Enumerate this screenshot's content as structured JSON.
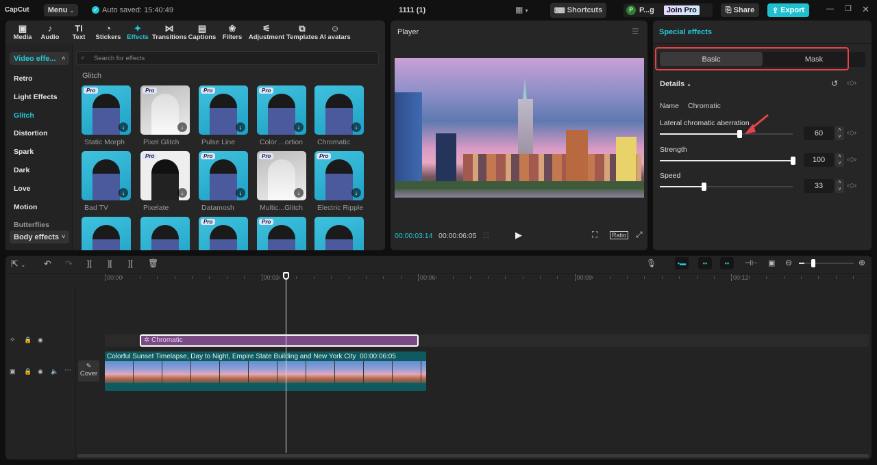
{
  "app": {
    "logo": "CapCut",
    "menu_label": "Menu",
    "autosave": "Auto saved: 15:40:49",
    "project_title": "1111 (1)"
  },
  "topbar": {
    "shortcuts": "Shortcuts",
    "user_initial": "P",
    "user_name": "P...g",
    "join_pro": "Join Pro",
    "share": "Share",
    "export": "Export"
  },
  "toolbar_tabs": [
    {
      "label": "Media",
      "icon": "▣"
    },
    {
      "label": "Audio",
      "icon": "♪"
    },
    {
      "label": "Text",
      "icon": "TI"
    },
    {
      "label": "Stickers",
      "icon": "◔"
    },
    {
      "label": "Effects",
      "icon": "✦"
    },
    {
      "label": "Transitions",
      "icon": "⋈"
    },
    {
      "label": "Captions",
      "icon": "▤"
    },
    {
      "label": "Filters",
      "icon": "❀"
    },
    {
      "label": "Adjustment",
      "icon": "⚟"
    },
    {
      "label": "Templates",
      "icon": "⧉"
    },
    {
      "label": "AI avatars",
      "icon": "☺"
    }
  ],
  "sidebar": {
    "video_effects": "Video effe...",
    "items": [
      "Retro",
      "Light Effects",
      "Glitch",
      "Distortion",
      "Spark",
      "Dark",
      "Love",
      "Motion",
      "Butterflies"
    ],
    "body_effects": "Body effects"
  },
  "effects": {
    "search_placeholder": "Search for effects",
    "section": "Glitch",
    "items": [
      {
        "name": "Static Morph",
        "pro": true
      },
      {
        "name": "Pixel Glitch",
        "pro": true
      },
      {
        "name": "Pulse Line",
        "pro": true
      },
      {
        "name": "Color ...ortion",
        "pro": true
      },
      {
        "name": "Chromatic",
        "pro": false
      },
      {
        "name": "Bad TV",
        "pro": false
      },
      {
        "name": "Pixelate",
        "pro": true
      },
      {
        "name": "Datamosh",
        "pro": true
      },
      {
        "name": "Multic...Glitch",
        "pro": true
      },
      {
        "name": "Electric Ripple",
        "pro": true
      },
      {
        "name": "",
        "pro": false
      },
      {
        "name": "",
        "pro": false
      },
      {
        "name": "",
        "pro": true
      },
      {
        "name": "",
        "pro": true
      },
      {
        "name": "",
        "pro": false
      }
    ],
    "pro_label": "Pro"
  },
  "player": {
    "title": "Player",
    "current_time": "00:00:03:14",
    "total_time": "00:00:06:05",
    "ratio": "Ratio"
  },
  "inspector": {
    "title": "Special effects",
    "tabs": [
      "Basic",
      "Mask"
    ],
    "details": "Details",
    "name_label": "Name",
    "name_value": "Chromatic",
    "params": [
      {
        "label": "Lateral chromatic aberration",
        "value": 60,
        "max": 100
      },
      {
        "label": "Strength",
        "value": 100,
        "max": 100
      },
      {
        "label": "Speed",
        "value": 33,
        "max": 100
      }
    ]
  },
  "timeline": {
    "ruler": [
      "00:00",
      "00:03",
      "00:06",
      "00:09",
      "00:12"
    ],
    "effect_clip": "Chromatic",
    "video_clip_title": "Colorful Sunset Timelapse, Day to Night, Empire State Building and New York City",
    "video_clip_duration": "00:00:06:05",
    "cover_label": "Cover",
    "zoom_level": 0.1
  },
  "colors": {
    "accent": "#21c8d6",
    "effect_clip": "#7a4a85",
    "video_clip": "#0e5a5e"
  }
}
